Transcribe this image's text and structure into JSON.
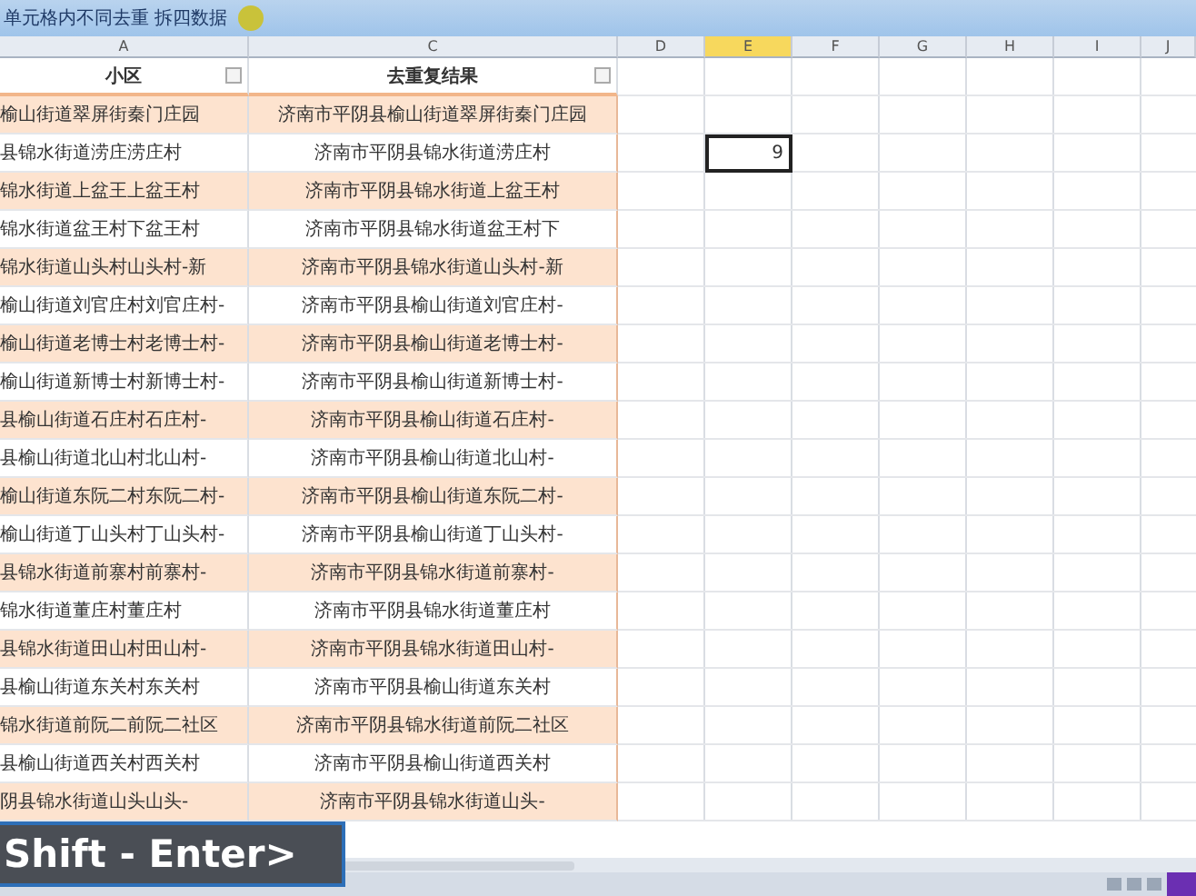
{
  "window": {
    "title": "单元格内不同去重 拆四数据"
  },
  "columns": [
    {
      "label": "A",
      "selected": false
    },
    {
      "label": "C",
      "selected": false
    },
    {
      "label": "D",
      "selected": false
    },
    {
      "label": "E",
      "selected": true
    },
    {
      "label": "F",
      "selected": false
    },
    {
      "label": "G",
      "selected": false
    },
    {
      "label": "H",
      "selected": false
    },
    {
      "label": "I",
      "selected": false
    },
    {
      "label": "J",
      "selected": false
    }
  ],
  "header_row": [
    "小区",
    "去重复结果"
  ],
  "rows": [
    {
      "a": "榆山街道翠屏街秦门庄园",
      "c": "济南市平阴县榆山街道翠屏街秦门庄园"
    },
    {
      "a": "县锦水街道涝庄涝庄村",
      "c": "济南市平阴县锦水街道涝庄村",
      "e": "9",
      "e_selected": true
    },
    {
      "a": "锦水街道上盆王上盆王村",
      "c": "济南市平阴县锦水街道上盆王村"
    },
    {
      "a": "锦水街道盆王村下盆王村",
      "c": "济南市平阴县锦水街道盆王村下"
    },
    {
      "a": "锦水街道山头村山头村-新",
      "c": "济南市平阴县锦水街道山头村-新"
    },
    {
      "a": "榆山街道刘官庄村刘官庄村-",
      "c": "济南市平阴县榆山街道刘官庄村-"
    },
    {
      "a": "榆山街道老博士村老博士村-",
      "c": "济南市平阴县榆山街道老博士村-"
    },
    {
      "a": "榆山街道新博士村新博士村-",
      "c": "济南市平阴县榆山街道新博士村-"
    },
    {
      "a": "县榆山街道石庄村石庄村-",
      "c": "济南市平阴县榆山街道石庄村-"
    },
    {
      "a": "县榆山街道北山村北山村-",
      "c": "济南市平阴县榆山街道北山村-"
    },
    {
      "a": "榆山街道东阮二村东阮二村-",
      "c": "济南市平阴县榆山街道东阮二村-"
    },
    {
      "a": "榆山街道丁山头村丁山头村-",
      "c": "济南市平阴县榆山街道丁山头村-"
    },
    {
      "a": "县锦水街道前寨村前寨村-",
      "c": "济南市平阴县锦水街道前寨村-"
    },
    {
      "a": "锦水街道董庄村董庄村",
      "c": "济南市平阴县锦水街道董庄村"
    },
    {
      "a": "县锦水街道田山村田山村-",
      "c": "济南市平阴县锦水街道田山村-"
    },
    {
      "a": "县榆山街道东关村东关村",
      "c": "济南市平阴县榆山街道东关村"
    },
    {
      "a": "锦水街道前阮二前阮二社区",
      "c": "济南市平阴县锦水街道前阮二社区"
    },
    {
      "a": "县榆山街道西关村西关村",
      "c": "济南市平阴县榆山街道西关村"
    },
    {
      "a": "阴县锦水街道山头山头-",
      "c": "济南市平阴县锦水街道山头-"
    }
  ],
  "keystroke_overlay": "Shift - Enter>"
}
